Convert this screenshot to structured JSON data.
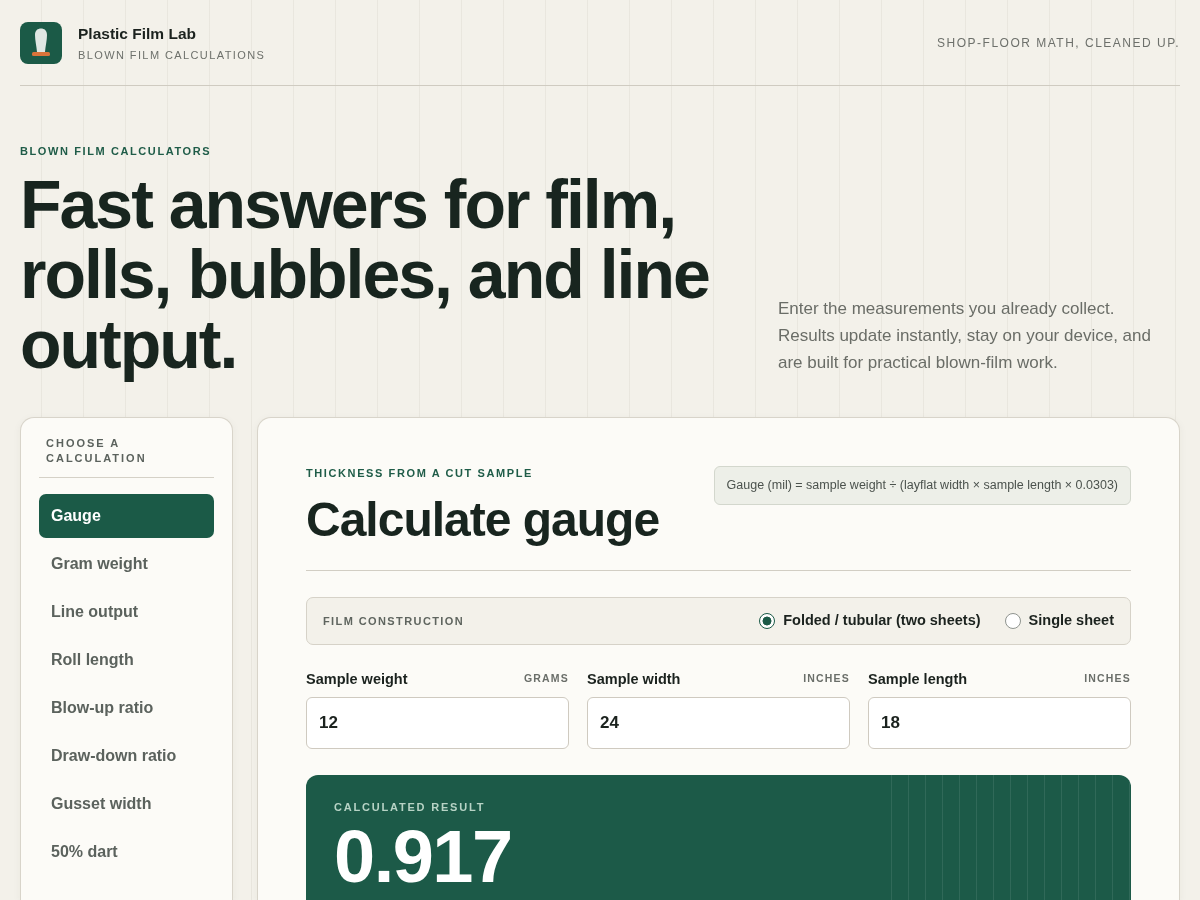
{
  "header": {
    "brand": "Plastic Film Lab",
    "subtitle": "BLOWN FILM CALCULATIONS",
    "tagline": "SHOP-FLOOR MATH, CLEANED UP."
  },
  "hero": {
    "eyebrow": "BLOWN FILM CALCULATORS",
    "headline": "Fast answers for film, rolls, bubbles, and line output.",
    "intro": "Enter the measurements you already collect. Results update instantly, stay on your device, and are built for practical blown-film work."
  },
  "sidebar": {
    "heading": "CHOOSE A CALCULATION",
    "items": [
      {
        "label": "Gauge",
        "selected": true
      },
      {
        "label": "Gram weight",
        "selected": false
      },
      {
        "label": "Line output",
        "selected": false
      },
      {
        "label": "Roll length",
        "selected": false
      },
      {
        "label": "Blow-up ratio",
        "selected": false
      },
      {
        "label": "Draw-down ratio",
        "selected": false
      },
      {
        "label": "Gusset width",
        "selected": false
      },
      {
        "label": "50% dart",
        "selected": false
      }
    ]
  },
  "calculator": {
    "eyebrow": "THICKNESS FROM A CUT SAMPLE",
    "title": "Calculate gauge",
    "formula": "Gauge (mil) = sample weight ÷ (layflat width × sample length × 0.0303)",
    "construction": {
      "label": "FILM CONSTRUCTION",
      "options": [
        {
          "label": "Folded / tubular (two sheets)",
          "selected": true
        },
        {
          "label": "Single sheet",
          "selected": false
        }
      ]
    },
    "fields": [
      {
        "label": "Sample weight",
        "unit": "GRAMS",
        "value": "12"
      },
      {
        "label": "Sample width",
        "unit": "INCHES",
        "value": "24"
      },
      {
        "label": "Sample length",
        "unit": "INCHES",
        "value": "18"
      }
    ],
    "result": {
      "label": "CALCULATED RESULT",
      "value": "0.917"
    }
  }
}
